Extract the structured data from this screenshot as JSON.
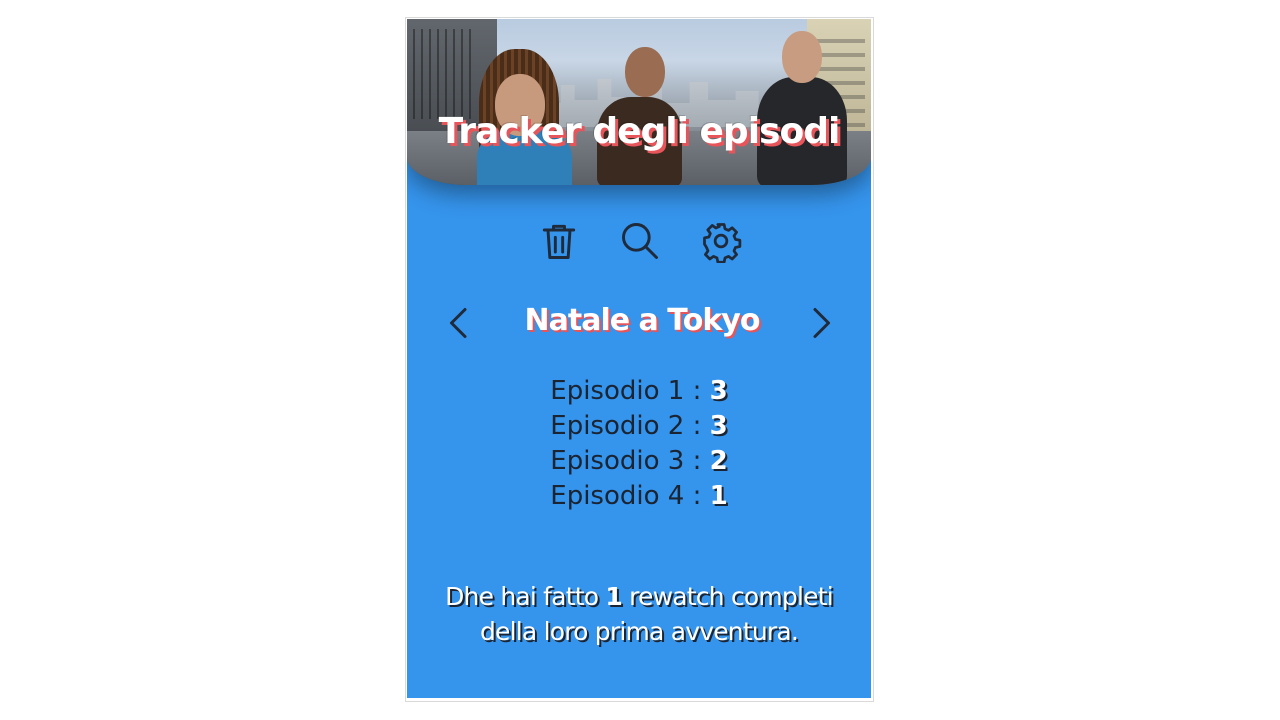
{
  "header": {
    "title": "Tracker degli episodi"
  },
  "toolbar": {
    "trash_icon": "trash-icon",
    "search_icon": "search-icon",
    "settings_icon": "gear-icon",
    "icon_color": "#1f2a3a"
  },
  "series": {
    "title": "Natale a Tokyo",
    "prev_icon": "chevron-left-icon",
    "next_icon": "chevron-right-icon"
  },
  "episodes": [
    {
      "label": "Episodio 1 :",
      "count": "3"
    },
    {
      "label": "Episodio 2 :",
      "count": "3"
    },
    {
      "label": "Episodio 3 :",
      "count": "2"
    },
    {
      "label": "Episodio 4 :",
      "count": "1"
    }
  ],
  "footer": {
    "prefix": "Dhe hai fatto",
    "count": "1",
    "suffix": "rewatch completi",
    "line2": "della loro prima avventura."
  },
  "colors": {
    "background": "#3594ec",
    "title_shadow": "#e5555a",
    "text_dark": "#1a2433"
  }
}
